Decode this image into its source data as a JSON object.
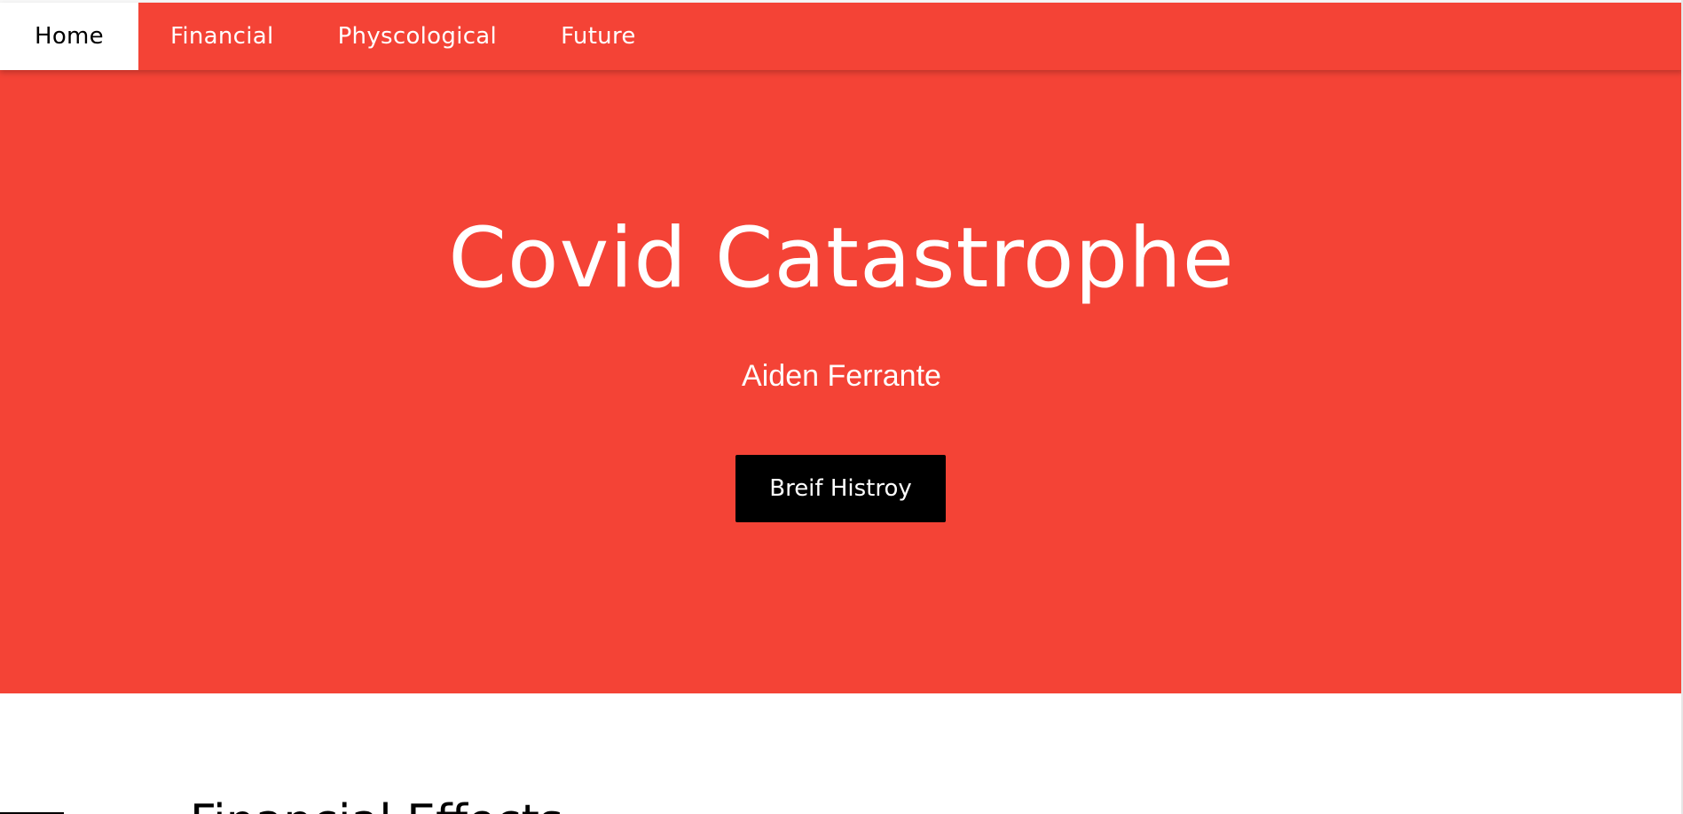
{
  "nav": {
    "items": [
      {
        "label": "Home",
        "active": true
      },
      {
        "label": "Financial",
        "active": false
      },
      {
        "label": "Physcological",
        "active": false
      },
      {
        "label": "Future",
        "active": false
      }
    ]
  },
  "hero": {
    "title": "Covid Catastrophe",
    "author": "Aiden Ferrante",
    "button_label": "Breif Histroy"
  },
  "section": {
    "heading": "Financial Effects"
  },
  "colors": {
    "brand_red": "#f44336",
    "button_black": "#000000",
    "text_white": "#ffffff"
  }
}
